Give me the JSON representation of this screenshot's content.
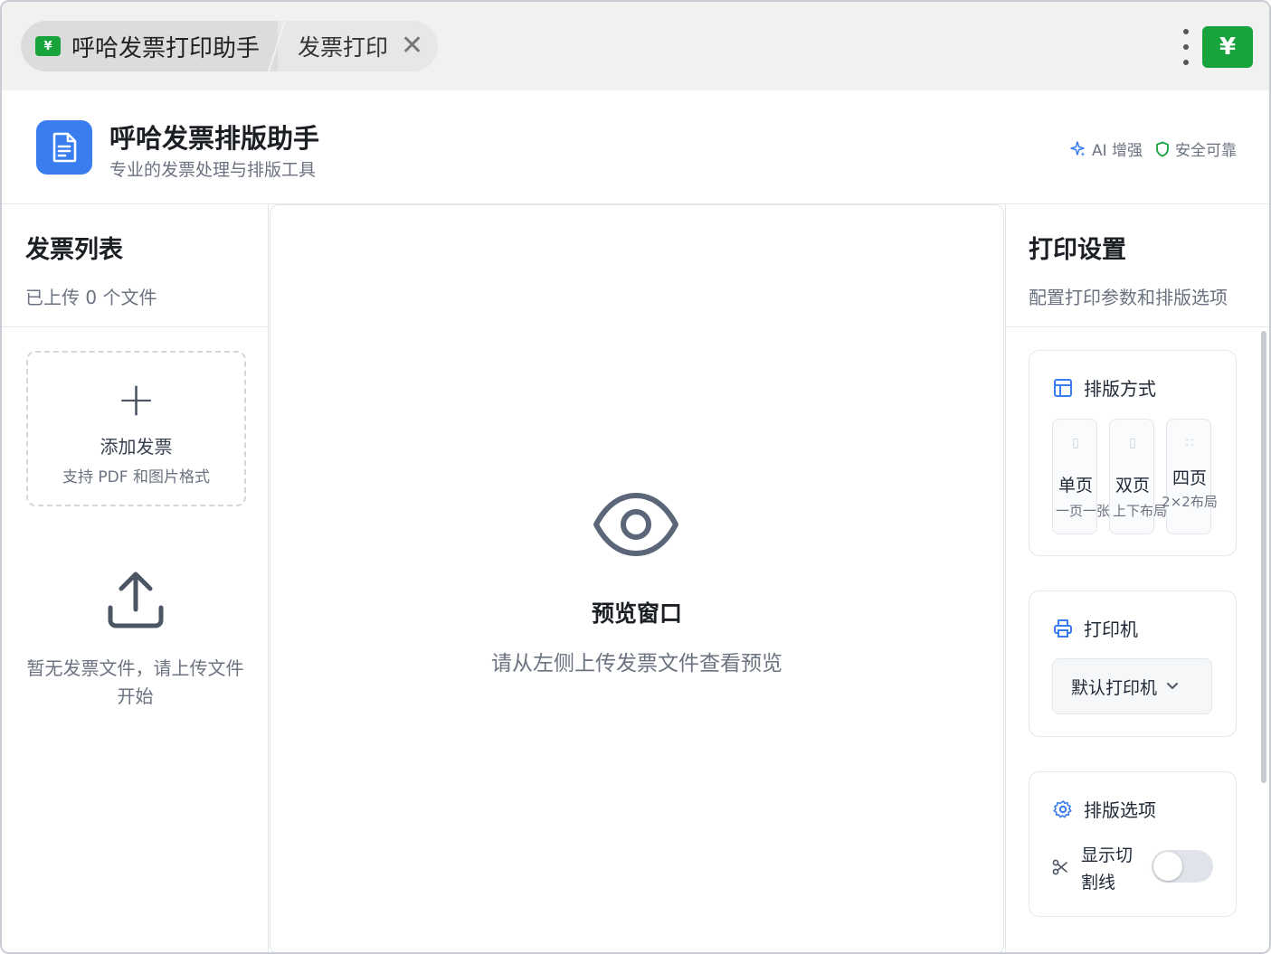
{
  "titlebar": {
    "app_tab_label": "呼哈发票打印助手",
    "app_logo_glyph": "¥",
    "doc_tab_label": "发票打印",
    "close_glyph": "✕"
  },
  "header": {
    "title": "呼哈发票排版助手",
    "subtitle": "专业的发票处理与排版工具",
    "badges": {
      "ai": "AI 增强",
      "secure": "安全可靠"
    }
  },
  "left": {
    "title": "发票列表",
    "count_text": "已上传 0 个文件",
    "add": {
      "plus": "+",
      "label": "添加发票",
      "hint": "支持 PDF 和图片格式"
    },
    "empty_text": "暂无发票文件，请上传文件开始"
  },
  "preview": {
    "title": "预览窗口",
    "subtitle": "请从左侧上传发票文件查看预览"
  },
  "settings": {
    "title": "打印设置",
    "subtitle": "配置打印参数和排版选项",
    "layout": {
      "title": "排版方式",
      "options": [
        {
          "name": "单页",
          "desc": "一页一张"
        },
        {
          "name": "双页",
          "desc": "上下布局"
        },
        {
          "name": "四页",
          "desc": "2×2布局"
        }
      ]
    },
    "printer": {
      "title": "打印机",
      "selected": "默认打印机"
    },
    "options": {
      "title": "排版选项",
      "cut_line_label": "显示切割线",
      "cut_line_on": false
    }
  },
  "colors": {
    "brand_green": "#18a33c",
    "accent_blue": "#3a7df0"
  }
}
